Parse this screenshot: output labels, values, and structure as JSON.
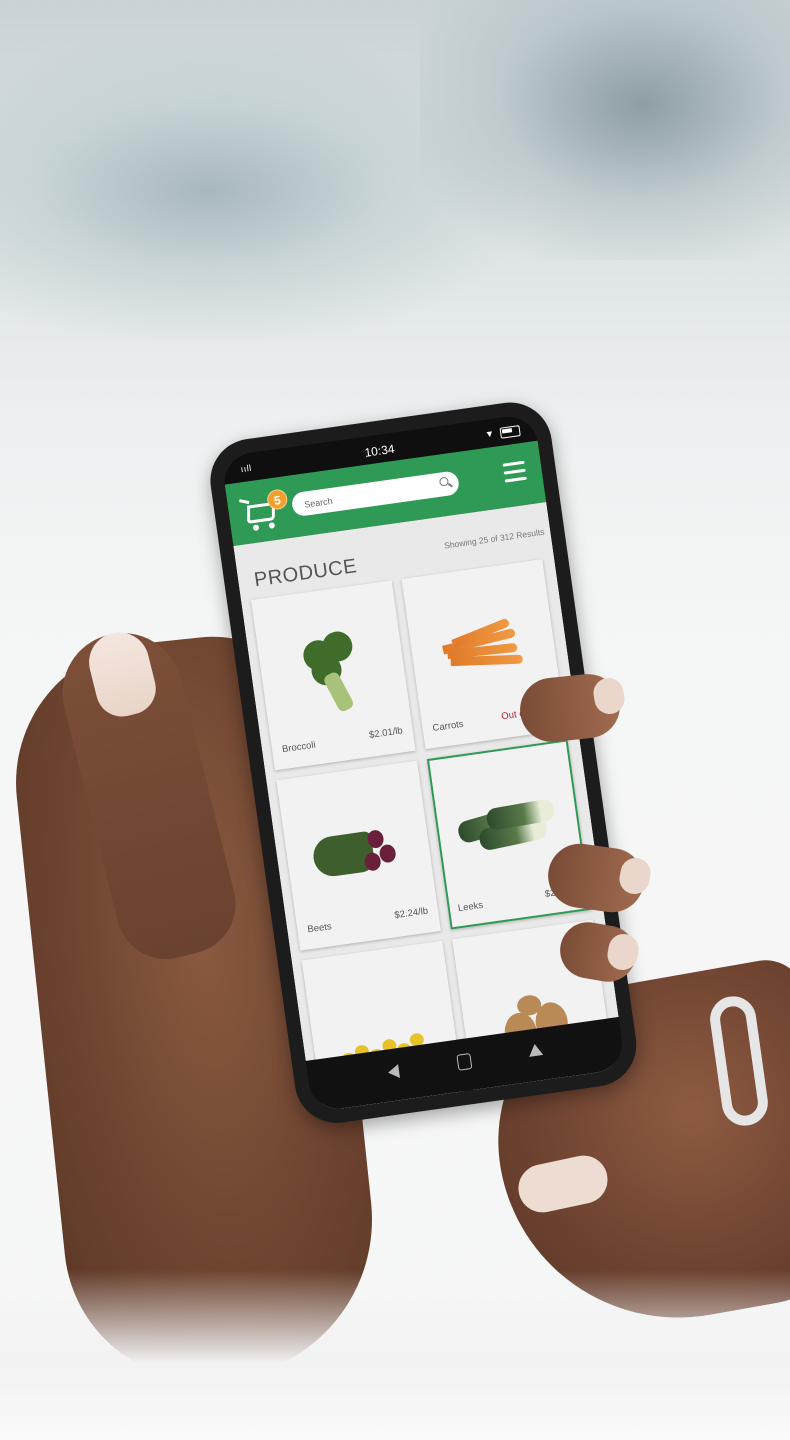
{
  "status_bar": {
    "signal": "ııll",
    "time": "10:34"
  },
  "header": {
    "cart_count": "5",
    "search_placeholder": "Search"
  },
  "section": {
    "title": "PRODUCE",
    "results": "Showing 25 of 312 Results"
  },
  "products": [
    {
      "name": "Broccoli",
      "price": "$2.01/lb"
    },
    {
      "name": "Carrots",
      "price": "Out of Stock"
    },
    {
      "name": "Beets",
      "price": "$2.24/lb"
    },
    {
      "name": "Leeks",
      "price": "$2.94/lb"
    },
    {
      "name": "",
      "price": ""
    },
    {
      "name": "",
      "price": ""
    }
  ],
  "colors": {
    "brand_green": "#2e9a55",
    "badge_orange": "#f0a02e",
    "out_of_stock_red": "#b3232b"
  },
  "icons": [
    "cart-icon",
    "search-icon",
    "hamburger-menu-icon",
    "wifi-icon",
    "battery-icon",
    "nav-back-icon",
    "nav-home-icon",
    "nav-recent-icon"
  ]
}
